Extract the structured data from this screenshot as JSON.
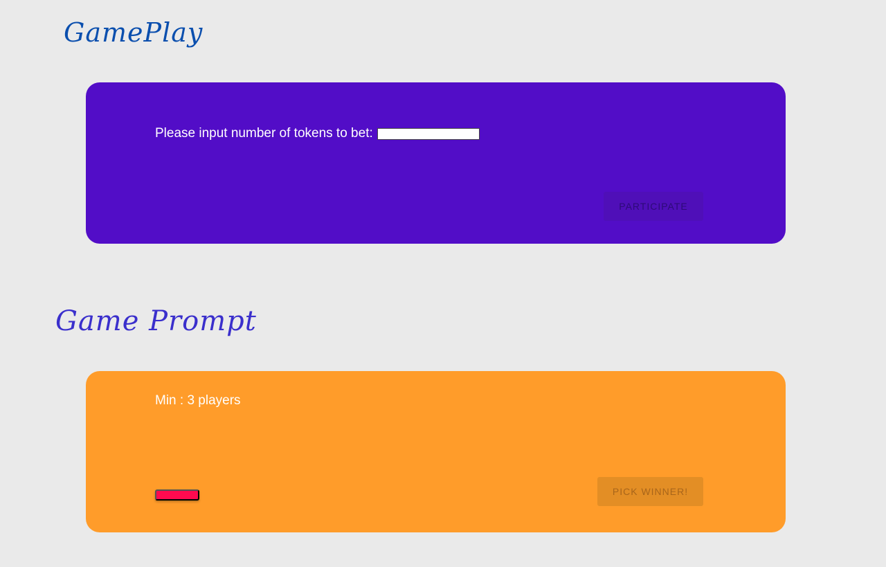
{
  "gameplay": {
    "title": "GamePlay",
    "bet_prompt": "Please input number of tokens to bet:",
    "bet_input_value": "",
    "participate_label": "PARTICIPATE"
  },
  "game_prompt": {
    "title": "Game Prompt",
    "min_players": "Min : 3 players",
    "pick_winner_label": "PICK WINNER!"
  },
  "colors": {
    "background": "#eaeaea",
    "gameplay_card": "#520dc7",
    "prompt_card": "#ff9c2a",
    "red_button": "#ff0a4f"
  }
}
